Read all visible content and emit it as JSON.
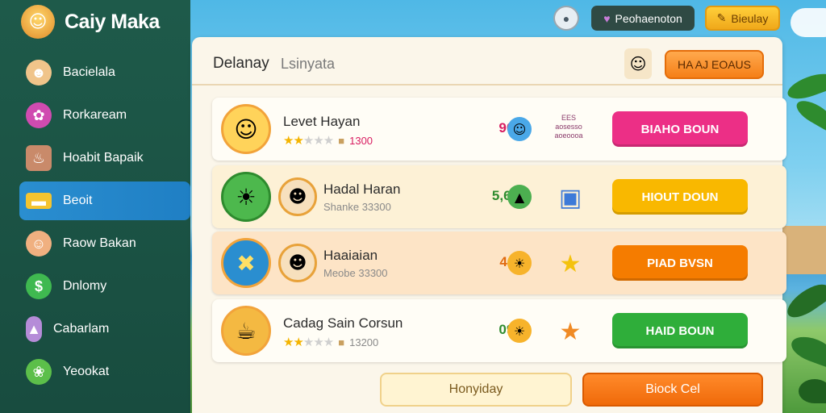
{
  "app": {
    "title": "Caiy Maka"
  },
  "topbar": {
    "help_icon": "help-icon",
    "profile_label": "Peohaenoton",
    "play_label": "Bieulay"
  },
  "sidebar": {
    "items": [
      {
        "label": "Bacielala",
        "icon": "villager-icon",
        "active": false
      },
      {
        "label": "Rorkaream",
        "icon": "candy-icon",
        "active": false
      },
      {
        "label": "Hoabit Bapaik",
        "icon": "basket-icon",
        "active": false
      },
      {
        "label": "Beoit",
        "icon": "gold-bar-icon",
        "active": true
      },
      {
        "label": "Raow Bakan",
        "icon": "girl-icon",
        "active": false
      },
      {
        "label": "Dnlomy",
        "icon": "dollar-icon",
        "active": false
      },
      {
        "label": "Cabarlam",
        "icon": "popsicle-icon",
        "active": false
      },
      {
        "label": "Yeookat",
        "icon": "leaf-icon",
        "active": false
      }
    ]
  },
  "panel": {
    "title": "Delanay",
    "subtitle": "Lsinyata",
    "header_button": "HA AJ EOAUS"
  },
  "rows": [
    {
      "name": "Levet Hayan",
      "meta": "1300",
      "stars": 2,
      "score": "90)",
      "score_color": "#d81b60",
      "token_color": "#4aa8e8",
      "reward_text": "EES aosesso aoeoooa",
      "button": "BIAHO BOUN",
      "button_color": "#ec2f86",
      "style": "white"
    },
    {
      "name": "Hadal Haran",
      "meta": "Shanke 33300",
      "stars": 0,
      "score": "5,63",
      "score_color": "#2e8b2e",
      "token_color": "#4caf50",
      "reward_text": "",
      "button": "HIOUT DOUN",
      "button_color": "#f9b800",
      "style": "cream"
    },
    {
      "name": "Haaiaian",
      "meta": "Meobe 33300",
      "stars": 0,
      "score": "4,7",
      "score_color": "#e06a10",
      "token_color": "#f7b32b",
      "reward_text": "",
      "button": "PIAD BVSN",
      "button_color": "#f57c00",
      "style": "peach"
    },
    {
      "name": "Cadag Sain Corsun",
      "meta": "13200",
      "stars": 2,
      "score": "09)",
      "score_color": "#2e8b2e",
      "token_color": "#f7b32b",
      "reward_text": "",
      "button": "HAID BOUN",
      "button_color": "#2fae3a",
      "style": "white"
    }
  ],
  "footer": {
    "left_button": "Honyiday",
    "right_button": "Biock Cel"
  },
  "colors": {
    "sidebar": "#1e5a4a",
    "accent": "#2a8ed0",
    "panel": "#fbf6ea"
  }
}
